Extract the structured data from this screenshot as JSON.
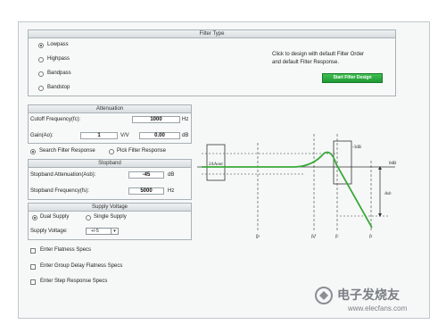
{
  "filter_type": {
    "title": "Filter Type",
    "options": [
      "Lowpass",
      "Highpass",
      "Bandpass",
      "Bandstop"
    ],
    "selected": "Lowpass",
    "instruction_line1": "Click to design with default Filter Order",
    "instruction_line2": "and default Filter Response.",
    "start_button": "Start Filter Design"
  },
  "attenuation": {
    "title": "Attenuation",
    "cutoff_label": "Cutoff Frequency(fc):",
    "cutoff_value": "1000",
    "cutoff_unit": "Hz",
    "gain_label": "Gain(Ao):",
    "gain_value": "1",
    "gain_unit_vv": "V/V",
    "gain_db_value": "0.00",
    "gain_db_unit": "dB"
  },
  "response_mode": {
    "search_label": "Search Filter Response",
    "pick_label": "Pick Filter Response",
    "selected": "Search Filter Response"
  },
  "stopband": {
    "title": "Stopband",
    "atten_label": "Stopband Attenuation(Asb):",
    "atten_value": "-45",
    "atten_unit": "dB",
    "freq_label": "Stopband Frequency(fs):",
    "freq_value": "5000",
    "freq_unit": "Hz"
  },
  "supply": {
    "title": "Supply Voltage",
    "dual_label": "Dual Supply",
    "single_label": "Single Supply",
    "selected": "Dual Supply",
    "voltage_label": "Supply Voltage:",
    "voltage_value": "+/-5"
  },
  "options": {
    "flatness": "Enter Flatness Specs",
    "group_delay": "Enter Group Delay Flatness Specs",
    "step_response": "Enter Step Response Specs"
  },
  "diagram": {
    "label_2dAout": "2ΔAout",
    "label_3db": "-3dB",
    "label_0db": "0dB",
    "label_asb": "Asb",
    "label_fp": "fp",
    "label_fsf": "fsf",
    "label_fc": "fc",
    "label_fs": "fs"
  },
  "watermark": {
    "cn": "电子发烧友",
    "url": "www.elecfans.com"
  },
  "colors": {
    "accent_green": "#2aa63b",
    "curve_green": "#3aa93a"
  }
}
